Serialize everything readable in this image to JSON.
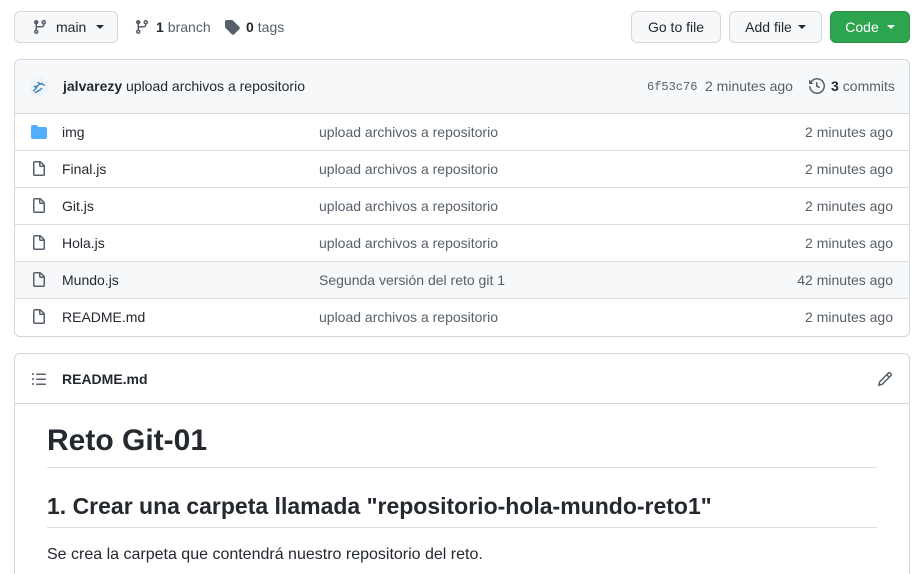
{
  "toolbar": {
    "branch_name": "main",
    "branches_count": "1",
    "branches_label": "branch",
    "tags_count": "0",
    "tags_label": "tags",
    "go_to_file": "Go to file",
    "add_file": "Add file",
    "code": "Code"
  },
  "commit": {
    "author": "jalvarezy",
    "message": "upload archivos a repositorio",
    "sha": "6f53c76",
    "time": "2 minutes ago",
    "count": "3",
    "count_label": "commits"
  },
  "files": [
    {
      "name": "img",
      "type": "folder",
      "message": "upload archivos a repositorio",
      "time": "2 minutes ago"
    },
    {
      "name": "Final.js",
      "type": "file",
      "message": "upload archivos a repositorio",
      "time": "2 minutes ago"
    },
    {
      "name": "Git.js",
      "type": "file",
      "message": "upload archivos a repositorio",
      "time": "2 minutes ago"
    },
    {
      "name": "Hola.js",
      "type": "file",
      "message": "upload archivos a repositorio",
      "time": "2 minutes ago"
    },
    {
      "name": "Mundo.js",
      "type": "file",
      "message": "Segunda versión del reto git 1",
      "time": "42 minutes ago"
    },
    {
      "name": "README.md",
      "type": "file",
      "message": "upload archivos a repositorio",
      "time": "2 minutes ago"
    }
  ],
  "readme": {
    "filename": "README.md",
    "h1": "Reto Git-01",
    "h2": "1. Crear una carpeta llamada \"repositorio-hola-mundo-reto1\"",
    "p1": "Se crea la carpeta que contendrá nuestro repositorio del reto."
  },
  "colors": {
    "accent_green": "#2da44e",
    "folder_blue": "#54aeff",
    "muted_text": "#57606a",
    "border": "#d0d7de"
  },
  "icons": {
    "branch": "git-branch-icon",
    "tag": "tag-icon",
    "history": "history-icon",
    "folder": "folder-icon",
    "file": "file-icon",
    "list": "list-unordered-icon",
    "edit": "pencil-icon"
  }
}
